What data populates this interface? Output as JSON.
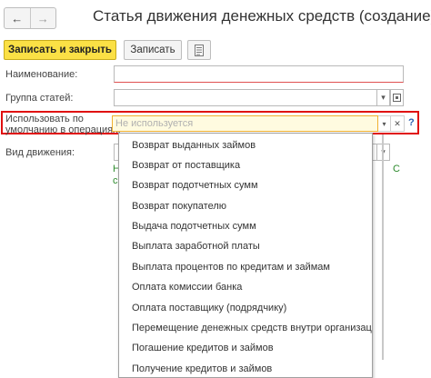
{
  "window": {
    "title": "Статья движения денежных средств (создание)"
  },
  "nav": {
    "back": "←",
    "forward": "→"
  },
  "toolbar": {
    "save_close": "Записать и закрыть",
    "save": "Записать"
  },
  "form": {
    "name_label": "Наименование:",
    "name_value": "",
    "group_label": "Группа статей:",
    "group_value": "",
    "default_use_label_line1": "Использовать по",
    "default_use_label_line2": "умолчанию в операциях:",
    "default_use_placeholder": "Не используется",
    "movement_label": "Вид движения:",
    "help_symbol": "?"
  },
  "dropdown": {
    "items": [
      "Возврат выданных займов",
      "Возврат от поставщика",
      "Возврат подотчетных сумм",
      "Возврат покупателю",
      "Выдача подотчетных сумм",
      "Выплата заработной платы",
      "Выплата процентов по кредитам и займам",
      "Оплата комиссии банка",
      "Оплата поставщику (подрядчику)",
      "Перемещение денежных средств внутри организации",
      "Погашение кредитов и займов",
      "Получение кредитов и займов"
    ]
  },
  "colors": {
    "primary_button": "#fbe045",
    "highlight_frame": "#e01010",
    "help": "#2a5fb0"
  },
  "icons": [
    "back-arrow-icon",
    "forward-arrow-icon",
    "document-list-icon",
    "dropdown-arrow-icon",
    "open-icon",
    "clear-icon"
  ]
}
